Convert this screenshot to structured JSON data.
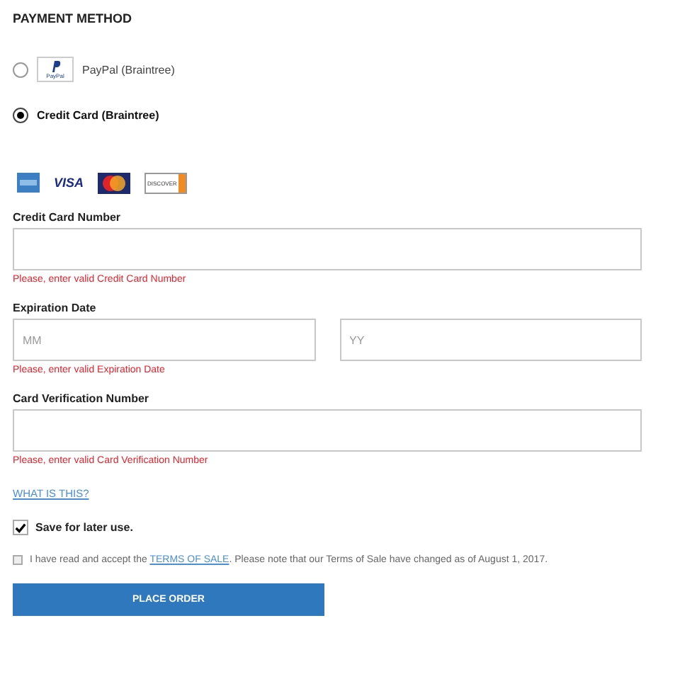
{
  "title": "PAYMENT METHOD",
  "payment_methods": [
    {
      "label": "PayPal (Braintree)",
      "selected": false,
      "logo_text": "PayPal"
    },
    {
      "label": "Credit Card (Braintree)",
      "selected": true
    }
  ],
  "card_logos": [
    {
      "kind": "amex"
    },
    {
      "kind": "visa",
      "text": "VISA"
    },
    {
      "kind": "mastercard"
    },
    {
      "kind": "discover",
      "text": "DISCOVER"
    }
  ],
  "fields": [
    {
      "label": "Credit Card Number",
      "error": "Please, enter valid Credit Card Number"
    },
    {
      "label": "Expiration Date",
      "inputs": [
        {
          "placeholder": "MM"
        },
        {
          "placeholder": "YY"
        }
      ],
      "error": "Please, enter valid Expiration Date"
    },
    {
      "label": "Card Verification Number",
      "error": "Please, enter valid Card Verification Number"
    }
  ],
  "help_link": "WHAT IS THIS?",
  "save": {
    "label": "Save for later use.",
    "checked": true
  },
  "terms": {
    "checked": false,
    "before": "I have read and accept the",
    "link": "TERMS OF SALE",
    "after": ". Please note that our Terms of Sale have changed as of August 1, 2017."
  },
  "button": "PLACE ORDER"
}
